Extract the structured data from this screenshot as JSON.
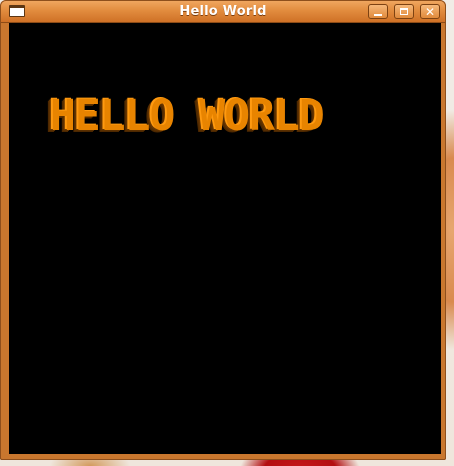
{
  "window": {
    "title": "Hello World",
    "controls": {
      "minimize_icon": "minimize-icon",
      "maximize_icon": "maximize-icon",
      "close_icon": "close-icon",
      "close_glyph": "✕"
    }
  },
  "canvas": {
    "text": "HELLO WORLD",
    "text_color": "#e88400",
    "background": "#000000"
  },
  "theme": {
    "titlebar": "#e28c3e"
  }
}
